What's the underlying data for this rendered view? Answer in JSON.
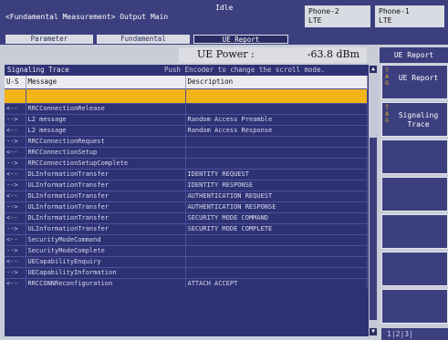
{
  "header": {
    "breadcrumb": "<Fundamental Measurement> Output Main",
    "status": "Idle",
    "phone2": {
      "name": "Phone-2",
      "tech": "LTE"
    },
    "phone1": {
      "name": "Phone-1",
      "tech": "LTE"
    }
  },
  "tabs": [
    {
      "label": "Parameter",
      "active": false
    },
    {
      "label": "Fundamental",
      "active": false
    },
    {
      "label": "UE Report",
      "active": true
    }
  ],
  "power": {
    "label": "UE Power :",
    "value": "-63.8 dBm"
  },
  "trace": {
    "title": "Signaling Trace",
    "hint": "Push Encoder to change the scroll mode.",
    "columns": [
      "U-S",
      "Message",
      "Description"
    ],
    "rows": [
      {
        "dir": "",
        "msg": "",
        "desc": ""
      },
      {
        "dir": "<--",
        "msg": "RRCConnectionRelease",
        "desc": ""
      },
      {
        "dir": "-->",
        "msg": "L2 message",
        "desc": "Random Access Preamble"
      },
      {
        "dir": "<--",
        "msg": "L2 message",
        "desc": "Random Access Response"
      },
      {
        "dir": "-->",
        "msg": "RRCConnectionRequest",
        "desc": ""
      },
      {
        "dir": "<--",
        "msg": "RRCConnectionSetup",
        "desc": ""
      },
      {
        "dir": "-->",
        "msg": "RRCConnectionSetupComplete",
        "desc": ""
      },
      {
        "dir": "<--",
        "msg": "DLInformationTransfer",
        "desc": "IDENTITY REQUEST"
      },
      {
        "dir": "-->",
        "msg": "ULInformationTransfer",
        "desc": "IDENTITY RESPONSE"
      },
      {
        "dir": "<--",
        "msg": "DLInformationTransfer",
        "desc": "AUTHENTICATION REQUEST"
      },
      {
        "dir": "-->",
        "msg": "ULInformationTransfer",
        "desc": "AUTHENTICATION RESPONSE"
      },
      {
        "dir": "<--",
        "msg": "DLInformationTransfer",
        "desc": "SECURITY MODE COMMAND"
      },
      {
        "dir": "-->",
        "msg": "ULInformationTransfer",
        "desc": "SECURITY MODE COMPLETE"
      },
      {
        "dir": "<--",
        "msg": "SecurityModeCommand",
        "desc": ""
      },
      {
        "dir": "-->",
        "msg": "SecurityModeComplete",
        "desc": ""
      },
      {
        "dir": "<--",
        "msg": "UECapabilityEnquiry",
        "desc": ""
      },
      {
        "dir": "-->",
        "msg": "UECapabilityInformation",
        "desc": ""
      },
      {
        "dir": "<--",
        "msg": "RRCCONNReconfiguration",
        "desc": "ATTACH ACCEPT"
      }
    ]
  },
  "side": {
    "title": "UE Report",
    "keys": [
      {
        "tag": "TAG",
        "label": "UE Report"
      },
      {
        "tag": "TAG",
        "label": "Signaling Trace"
      },
      {
        "tag": "",
        "label": ""
      },
      {
        "tag": "",
        "label": ""
      },
      {
        "tag": "",
        "label": ""
      },
      {
        "tag": "",
        "label": ""
      },
      {
        "tag": "",
        "label": ""
      }
    ],
    "pager": "1|2|3|"
  }
}
